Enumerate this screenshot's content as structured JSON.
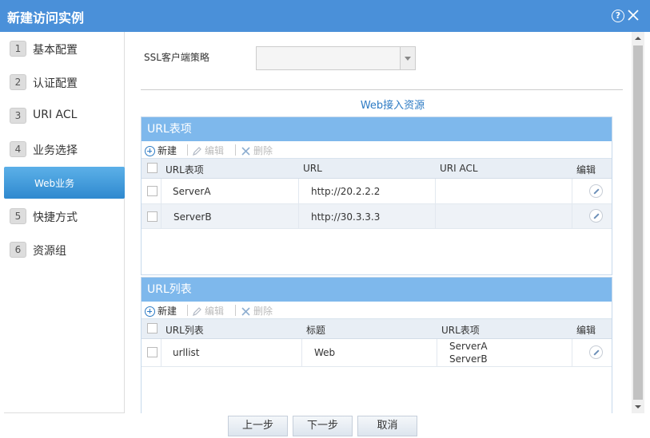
{
  "dialog": {
    "title": "新建访问实例"
  },
  "sidebar": {
    "items": [
      {
        "num": "1",
        "label": "基本配置"
      },
      {
        "num": "2",
        "label": "认证配置"
      },
      {
        "num": "3",
        "label": "URI ACL"
      },
      {
        "num": "4",
        "label": "业务选择"
      },
      {
        "num": "5",
        "label": "快捷方式"
      },
      {
        "num": "6",
        "label": "资源组"
      }
    ],
    "sub_item": "Web业务"
  },
  "form": {
    "ssl_label": "SSL客户端策略",
    "ssl_value": ""
  },
  "section_title": "Web接入资源",
  "url_items": {
    "title": "URL表项",
    "toolbar": {
      "add": "新建",
      "edit": "编辑",
      "delete": "删除"
    },
    "columns": [
      "URL表项",
      "URL",
      "URI ACL",
      "编辑"
    ],
    "rows": [
      {
        "name": "ServerA",
        "url": "http://20.2.2.2",
        "acl": ""
      },
      {
        "name": "ServerB",
        "url": "http://30.3.3.3",
        "acl": ""
      }
    ]
  },
  "url_lists": {
    "title": "URL列表",
    "toolbar": {
      "add": "新建",
      "edit": "编辑",
      "delete": "删除"
    },
    "columns": [
      "URL列表",
      "标题",
      "URL表项",
      "编辑"
    ],
    "rows": [
      {
        "name": "urllist",
        "title": "Web",
        "items": [
          "ServerA",
          "ServerB"
        ]
      }
    ]
  },
  "footer": {
    "prev": "上一步",
    "next": "下一步",
    "cancel": "取消"
  }
}
